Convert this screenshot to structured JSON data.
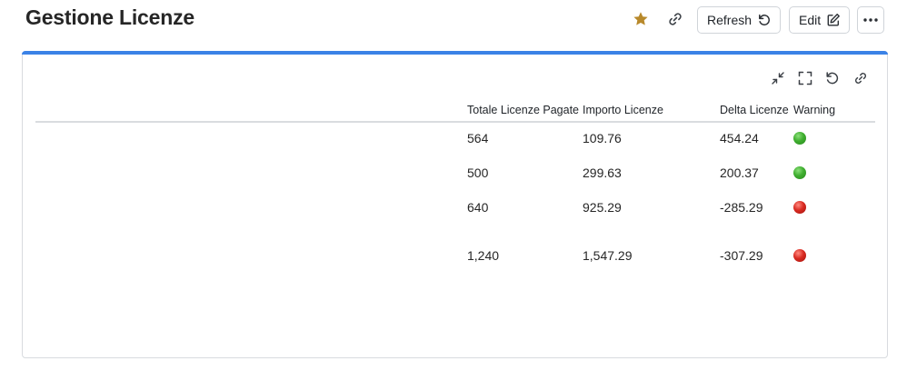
{
  "header": {
    "title": "Gestione Licenze",
    "refresh_label": "Refresh",
    "edit_label": "Edit",
    "star_color": "#b8892b",
    "icons": [
      "star-icon",
      "link-icon",
      "refresh-icon",
      "edit-icon",
      "more-icon"
    ]
  },
  "card": {
    "accent_color": "#3b82e6",
    "toolbar_icons": [
      "minimize-icon",
      "fullscreen-icon",
      "reset-icon",
      "link-icon"
    ],
    "columns": [
      "Totale Licenze Pagate",
      "Importo Licenze",
      "Delta Licenze",
      "Warning"
    ],
    "rows": [
      {
        "totale": "564",
        "importo": "109.76",
        "delta": "454.24",
        "warning": "green"
      },
      {
        "totale": "500",
        "importo": "299.63",
        "delta": "200.37",
        "warning": "green"
      },
      {
        "totale": "640",
        "importo": "925.29",
        "delta": "-285.29",
        "warning": "red"
      }
    ],
    "total_row": {
      "totale": "1,240",
      "importo": "1,547.29",
      "delta": "-307.29",
      "warning": "red"
    }
  }
}
